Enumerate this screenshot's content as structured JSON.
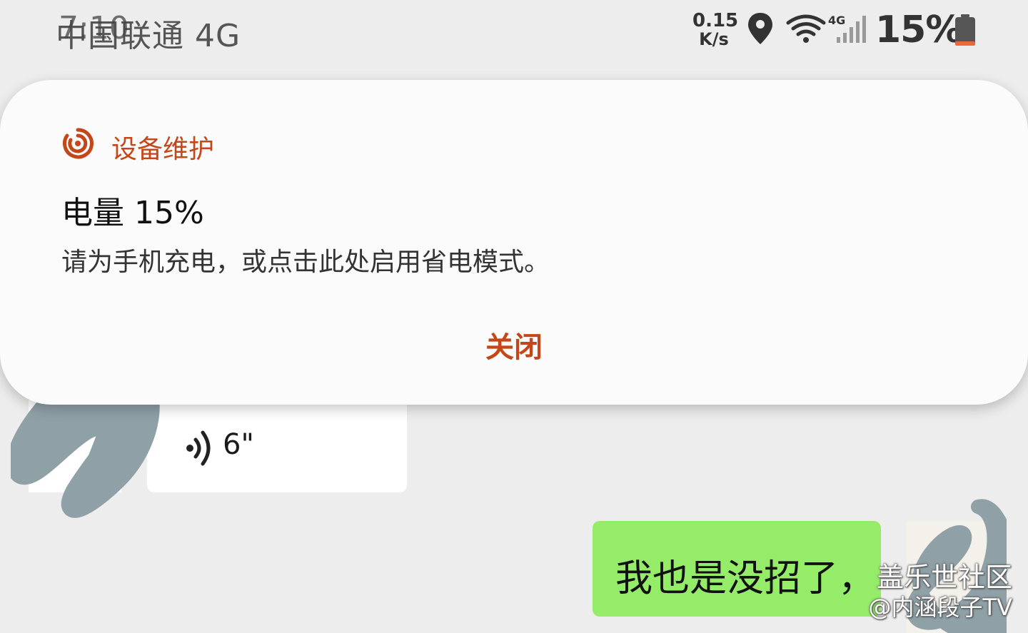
{
  "status_bar": {
    "carrier": "中国联通 4G",
    "time": "7:10",
    "net_speed_value": "0.15",
    "net_speed_unit": "K/s",
    "network_type": "4G",
    "battery_percent": "15%",
    "icons": [
      "location-icon",
      "wifi-icon",
      "cellular-signal-icon",
      "battery-icon"
    ],
    "battery_low_color": "#f0683a"
  },
  "notification": {
    "app_name": "设备维护",
    "app_icon": "device-care-icon",
    "title": "电量 15%",
    "body": "请为手机充电，或点击此处启用省电模式。",
    "close_label": "关闭",
    "accent_color": "#c4471a"
  },
  "chat": {
    "voice_message_duration": "6\"",
    "sent_message": "我也是没招了，",
    "sent_bubble_color": "#95ec69"
  },
  "watermark": {
    "line1": "盖乐世社区",
    "line2": "@内涵段子TV"
  }
}
